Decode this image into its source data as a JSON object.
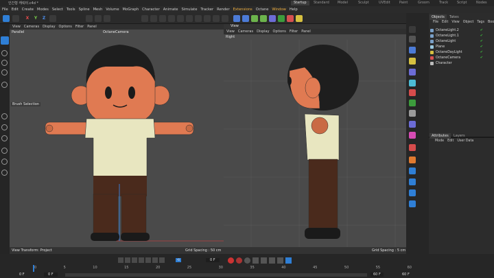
{
  "window": {
    "title": "인간형 캐릭터.c4d *"
  },
  "layouts": [
    "Startup",
    "Standard",
    "Model",
    "Sculpt",
    "UVEdit",
    "Paint",
    "Groom",
    "Track",
    "Script",
    "Nodes"
  ],
  "menu": [
    "File",
    "Edit",
    "Create",
    "Modes",
    "Select",
    "Tools",
    "Spline",
    "Mesh",
    "Volume",
    "MoGraph",
    "Character",
    "Animate",
    "Simulate",
    "Tracker",
    "Render",
    "Extensions",
    "Octane",
    "Window",
    "Help"
  ],
  "axis": [
    "X",
    "Y",
    "Z"
  ],
  "viewport_left": {
    "menu": [
      "View",
      "Cameras",
      "Display",
      "Options",
      "Filter",
      "Panel"
    ],
    "projection": "Parallel",
    "camera": "OctaneCamera",
    "tool_label": "Brush Selection",
    "status_left": "View Transform: Project",
    "grid": "Grid Spacing : 50 cm"
  },
  "viewport_right": {
    "top_label": "View",
    "menu": [
      "View",
      "Cameras",
      "Display",
      "Options",
      "Filter",
      "Panel"
    ],
    "projection": "Right",
    "grid": "Grid Spacing : 5 cm"
  },
  "objects_panel": {
    "tabs": [
      "Objects",
      "Takes"
    ],
    "menu": [
      "File",
      "Edit",
      "View",
      "Object",
      "Tags",
      "Boo"
    ],
    "items": [
      "OctaneLight.2",
      "OctaneLight.1",
      "OctaneLight",
      "Plane",
      "OctaneDayLight",
      "OctaneCamera",
      "Character"
    ]
  },
  "attributes_panel": {
    "tabs": [
      "Attributes",
      "Layers"
    ],
    "menu": [
      "Mode",
      "Edit",
      "User Data"
    ]
  },
  "timeline": {
    "start": "0 F",
    "start2": "0 F",
    "current": "0 F",
    "end": "60 F",
    "end2": "60 F",
    "ticks": [
      "0",
      "5",
      "10",
      "15",
      "20",
      "25",
      "30",
      "35",
      "40",
      "45",
      "50",
      "55",
      "60"
    ]
  },
  "colors": {
    "accent": "#2f7fd6",
    "skin": "#e07a52",
    "shirt": "#e8e6c0",
    "pants": "#4a2a1c",
    "hair": "#1e1e1e"
  }
}
